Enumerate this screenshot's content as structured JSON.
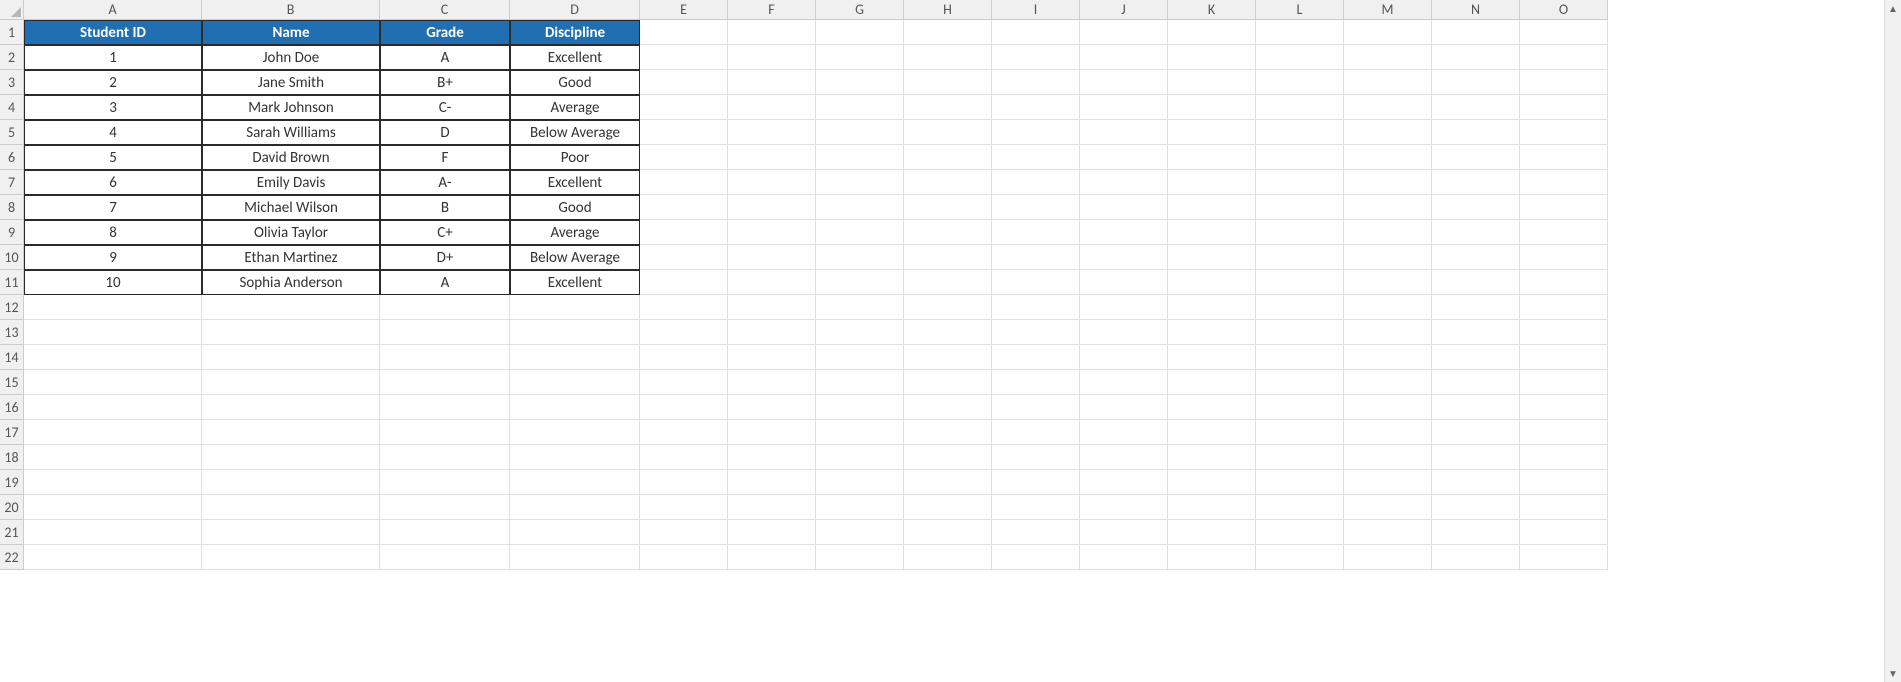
{
  "columns": [
    "A",
    "B",
    "C",
    "D",
    "E",
    "F",
    "G",
    "H",
    "I",
    "J",
    "K",
    "L",
    "M",
    "N",
    "O"
  ],
  "row_count_visible": 22,
  "table": {
    "headers": [
      "Student ID",
      "Name",
      "Grade",
      "Discipline"
    ],
    "rows": [
      {
        "id": "1",
        "name": "John Doe",
        "grade": "A",
        "discipline": "Excellent"
      },
      {
        "id": "2",
        "name": "Jane Smith",
        "grade": "B+",
        "discipline": "Good"
      },
      {
        "id": "3",
        "name": "Mark Johnson",
        "grade": "C-",
        "discipline": "Average"
      },
      {
        "id": "4",
        "name": "Sarah Williams",
        "grade": "D",
        "discipline": "Below Average"
      },
      {
        "id": "5",
        "name": "David Brown",
        "grade": "F",
        "discipline": "Poor"
      },
      {
        "id": "6",
        "name": "Emily Davis",
        "grade": "A-",
        "discipline": "Excellent"
      },
      {
        "id": "7",
        "name": "Michael Wilson",
        "grade": "B",
        "discipline": "Good"
      },
      {
        "id": "8",
        "name": "Olivia Taylor",
        "grade": "C+",
        "discipline": "Average"
      },
      {
        "id": "9",
        "name": "Ethan Martinez",
        "grade": "D+",
        "discipline": "Below Average"
      },
      {
        "id": "10",
        "name": "Sophia Anderson",
        "grade": "A",
        "discipline": "Excellent"
      }
    ]
  },
  "scroll": {
    "up": "▲",
    "down": "▼"
  }
}
